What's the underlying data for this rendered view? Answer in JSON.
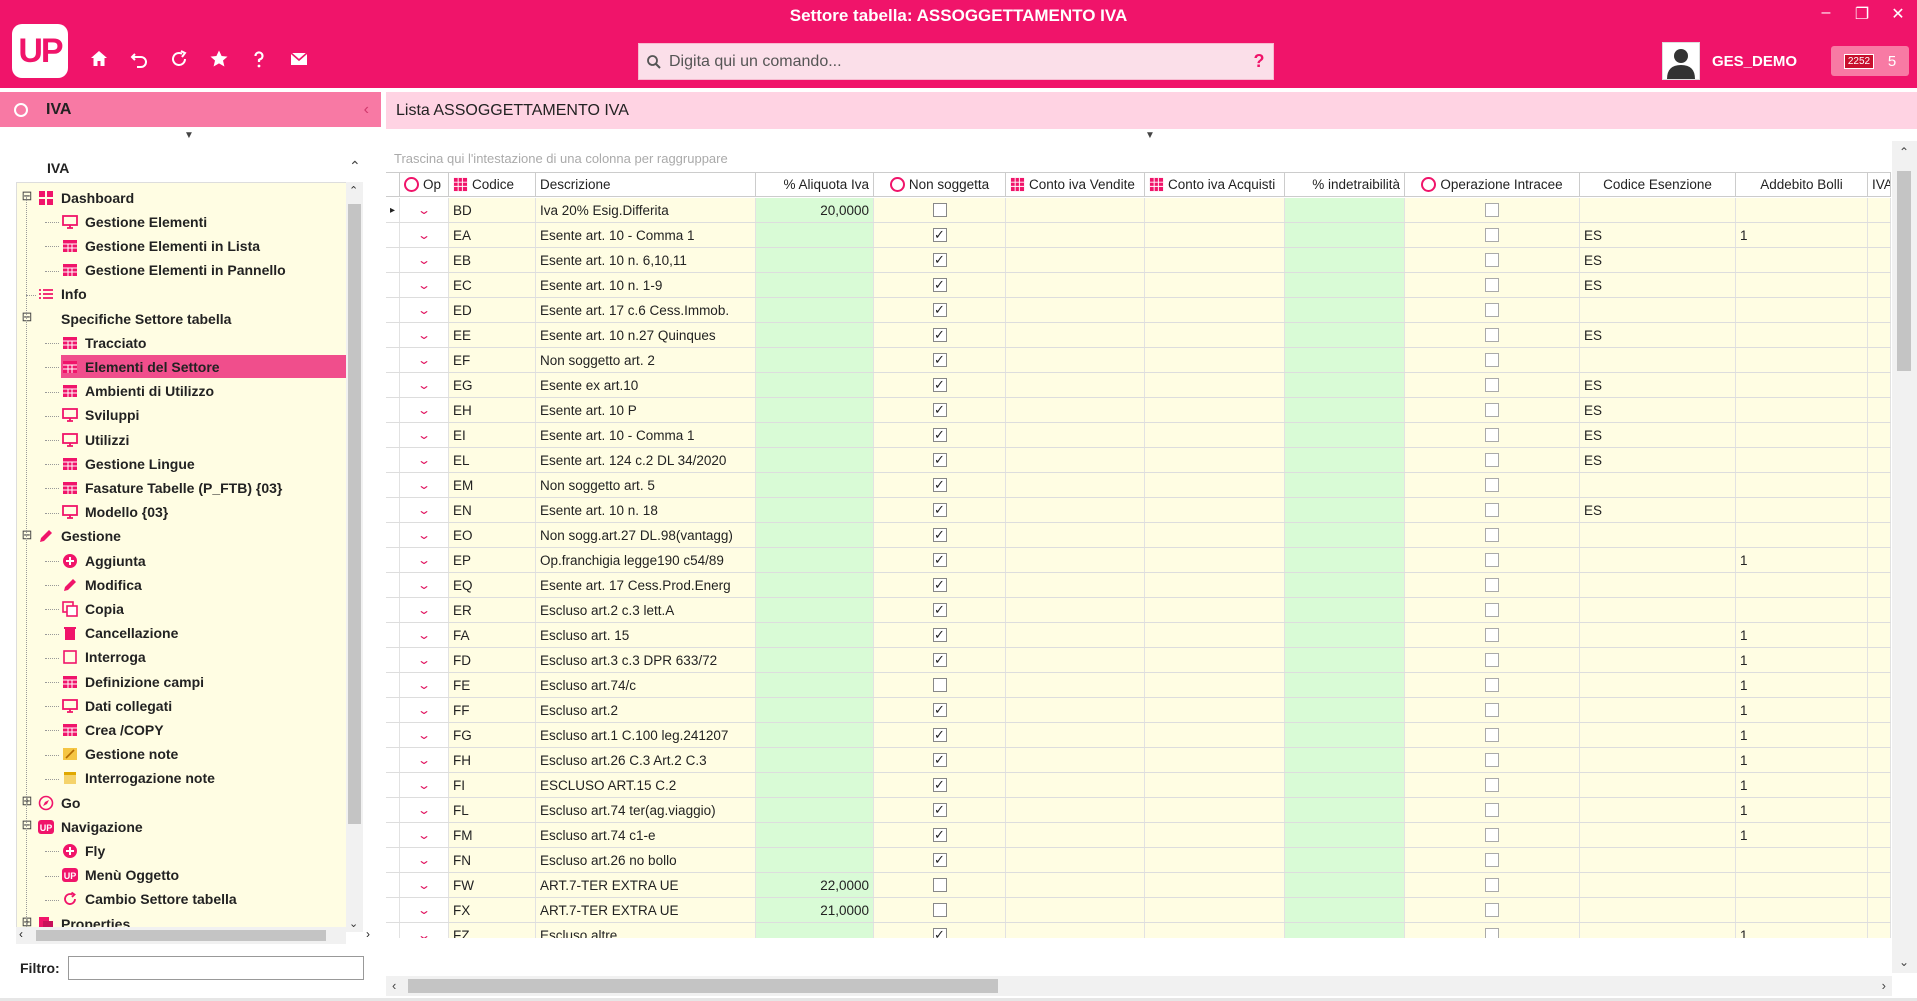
{
  "window": {
    "title": "Settore tabella: ASSOGGETTAMENTO IVA",
    "minimize": "–",
    "restore": "❐",
    "close": "✕"
  },
  "app": {
    "logo_text": "UP",
    "accent_color": "#f0146a",
    "panel_color": "#f879a4",
    "tree_bg": "#fffde3",
    "green_col": "#d9fbd6"
  },
  "toolbar": {
    "icons": [
      "home-icon",
      "undo-icon",
      "refresh-icon",
      "star-icon",
      "help-icon",
      "mail-icon"
    ]
  },
  "command": {
    "placeholder": "Digita qui un comando...",
    "help": "?"
  },
  "user": {
    "name": "GES_DEMO",
    "notif_badge": "2252",
    "notif_count": "5"
  },
  "left": {
    "title": "IVA",
    "collapse": "‹",
    "drop": "▼",
    "section": "IVA",
    "section_up": "⌃",
    "filter_label": "Filtro:",
    "filter_value": "",
    "scroll_left": "‹",
    "scroll_right": "›",
    "scroll_up": "⌃",
    "scroll_down": "⌄",
    "tree": [
      {
        "label": "Dashboard",
        "depth": 0,
        "icon": "dashboard-icon",
        "expander": "⊟"
      },
      {
        "label": "Gestione Elementi",
        "depth": 1,
        "icon": "monitor-icon"
      },
      {
        "label": "Gestione Elementi in Lista",
        "depth": 1,
        "icon": "grid-icon"
      },
      {
        "label": "Gestione Elementi in Pannello",
        "depth": 1,
        "icon": "grid-icon"
      },
      {
        "label": "Info",
        "depth": 0,
        "icon": "list-icon"
      },
      {
        "label": "Specifiche Settore tabella",
        "depth": 0,
        "icon": "",
        "expander": "⊟"
      },
      {
        "label": "Tracciato",
        "depth": 1,
        "icon": "grid-icon"
      },
      {
        "label": "Elementi del Settore",
        "depth": 1,
        "icon": "grid-icon",
        "selected": true
      },
      {
        "label": "Ambienti di Utilizzo",
        "depth": 1,
        "icon": "grid-icon"
      },
      {
        "label": "Sviluppi",
        "depth": 1,
        "icon": "monitor-icon"
      },
      {
        "label": "Utilizzi",
        "depth": 1,
        "icon": "monitor-icon"
      },
      {
        "label": "Gestione Lingue",
        "depth": 1,
        "icon": "grid-icon"
      },
      {
        "label": "Fasature Tabelle (P_FTB) {03}",
        "depth": 1,
        "icon": "grid-icon"
      },
      {
        "label": "Modello {03}",
        "depth": 1,
        "icon": "monitor-icon"
      },
      {
        "label": "Gestione",
        "depth": 0,
        "icon": "pencil-icon",
        "expander": "⊟"
      },
      {
        "label": "Aggiunta",
        "depth": 1,
        "icon": "add-circle-icon"
      },
      {
        "label": "Modifica",
        "depth": 1,
        "icon": "pencil-icon"
      },
      {
        "label": "Copia",
        "depth": 1,
        "icon": "copy-icon"
      },
      {
        "label": "Cancellazione",
        "depth": 1,
        "icon": "trash-icon"
      },
      {
        "label": "Interroga",
        "depth": 1,
        "icon": "square-icon"
      },
      {
        "label": "Definizione campi",
        "depth": 1,
        "icon": "grid-icon"
      },
      {
        "label": "Dati collegati",
        "depth": 1,
        "icon": "monitor-icon"
      },
      {
        "label": "Crea /COPY",
        "depth": 1,
        "icon": "grid-icon"
      },
      {
        "label": "Gestione note",
        "depth": 1,
        "icon": "note-edit-icon"
      },
      {
        "label": "Interrogazione note",
        "depth": 1,
        "icon": "note-icon"
      },
      {
        "label": "Go",
        "depth": 0,
        "icon": "compass-icon",
        "expander": "⊞"
      },
      {
        "label": "Navigazione",
        "depth": 0,
        "icon": "up-logo-icon",
        "expander": "⊟"
      },
      {
        "label": "Fly",
        "depth": 1,
        "icon": "add-circle-icon"
      },
      {
        "label": "Menù Oggetto",
        "depth": 1,
        "icon": "up-logo-icon"
      },
      {
        "label": "Cambio Settore tabella",
        "depth": 1,
        "icon": "refresh-icon"
      },
      {
        "label": "Properties",
        "depth": 0,
        "icon": "properties-icon",
        "expander": "⊞"
      }
    ]
  },
  "list": {
    "title": "Lista ASSOGGETTAMENTO IVA",
    "drop": "▼",
    "group_hint": "Trascina qui l'intestazione di una colonna per raggruppare",
    "scroll_up": "⌃",
    "scroll_down": "⌄",
    "scroll_left": "‹",
    "scroll_right": "›",
    "columns": [
      "Op",
      "Codice",
      "Descrizione",
      "% Aliquota Iva",
      "Non soggetta",
      "Conto iva Vendite",
      "Conto iva Acquisti",
      "% indetraibilità",
      "Operazione Intracee",
      "Codice Esenzione",
      "Addebito Bolli",
      "IVA"
    ],
    "row_pointer": "▸",
    "chevron": "⌄",
    "check_mark": "✓",
    "rows": [
      {
        "code": "BD",
        "desc": "Iva 20% Esig.Differita",
        "aliq": "20,0000",
        "non_sogg": false,
        "esenz": "",
        "bolli": "",
        "pointer": true
      },
      {
        "code": "EA",
        "desc": "Esente art. 10 - Comma 1",
        "aliq": "",
        "non_sogg": true,
        "esenz": "ES",
        "bolli": "1"
      },
      {
        "code": "EB",
        "desc": "Esente art. 10 n. 6,10,11",
        "aliq": "",
        "non_sogg": true,
        "esenz": "ES",
        "bolli": ""
      },
      {
        "code": "EC",
        "desc": "Esente art. 10 n. 1-9",
        "aliq": "",
        "non_sogg": true,
        "esenz": "ES",
        "bolli": ""
      },
      {
        "code": "ED",
        "desc": "Esente art. 17 c.6 Cess.Immob.",
        "aliq": "",
        "non_sogg": true,
        "esenz": "",
        "bolli": ""
      },
      {
        "code": "EE",
        "desc": "Esente art. 10 n.27 Quinques",
        "aliq": "",
        "non_sogg": true,
        "esenz": "ES",
        "bolli": ""
      },
      {
        "code": "EF",
        "desc": "Non soggetto art. 2",
        "aliq": "",
        "non_sogg": true,
        "esenz": "",
        "bolli": ""
      },
      {
        "code": "EG",
        "desc": "Esente ex art.10",
        "aliq": "",
        "non_sogg": true,
        "esenz": "ES",
        "bolli": ""
      },
      {
        "code": "EH",
        "desc": "Esente art.  10 P",
        "aliq": "",
        "non_sogg": true,
        "esenz": "ES",
        "bolli": ""
      },
      {
        "code": "EI",
        "desc": "Esente art. 10 - Comma 1",
        "aliq": "",
        "non_sogg": true,
        "esenz": "ES",
        "bolli": ""
      },
      {
        "code": "EL",
        "desc": "Esente art. 124 c.2 DL 34/2020",
        "aliq": "",
        "non_sogg": true,
        "esenz": "ES",
        "bolli": ""
      },
      {
        "code": "EM",
        "desc": "Non soggetto art. 5",
        "aliq": "",
        "non_sogg": true,
        "esenz": "",
        "bolli": ""
      },
      {
        "code": "EN",
        "desc": "Esente art. 10 n. 18",
        "aliq": "",
        "non_sogg": true,
        "esenz": "ES",
        "bolli": ""
      },
      {
        "code": "EO",
        "desc": "Non sogg.art.27 DL.98(vantagg)",
        "aliq": "",
        "non_sogg": true,
        "esenz": "",
        "bolli": ""
      },
      {
        "code": "EP",
        "desc": "Op.franchigia legge190 c54/89",
        "aliq": "",
        "non_sogg": true,
        "esenz": "",
        "bolli": "1"
      },
      {
        "code": "EQ",
        "desc": "Esente art. 17 Cess.Prod.Energ",
        "aliq": "",
        "non_sogg": true,
        "esenz": "",
        "bolli": ""
      },
      {
        "code": "ER",
        "desc": "Escluso art.2 c.3 lett.A",
        "aliq": "",
        "non_sogg": true,
        "esenz": "",
        "bolli": ""
      },
      {
        "code": "FA",
        "desc": "Escluso art. 15",
        "aliq": "",
        "non_sogg": true,
        "esenz": "",
        "bolli": "1"
      },
      {
        "code": "FD",
        "desc": "Escluso art.3 c.3 DPR 633/72",
        "aliq": "",
        "non_sogg": true,
        "esenz": "",
        "bolli": "1"
      },
      {
        "code": "FE",
        "desc": "Escluso art.74/c",
        "aliq": "",
        "non_sogg": false,
        "esenz": "",
        "bolli": "1"
      },
      {
        "code": "FF",
        "desc": "Escluso art.2",
        "aliq": "",
        "non_sogg": true,
        "esenz": "",
        "bolli": "1"
      },
      {
        "code": "FG",
        "desc": "Escluso art.1 C.100 leg.241207",
        "aliq": "",
        "non_sogg": true,
        "esenz": "",
        "bolli": "1"
      },
      {
        "code": "FH",
        "desc": "Escluso art.26 C.3 Art.2 C.3",
        "aliq": "",
        "non_sogg": true,
        "esenz": "",
        "bolli": "1"
      },
      {
        "code": "FI",
        "desc": "ESCLUSO ART.15 C.2",
        "aliq": "",
        "non_sogg": true,
        "esenz": "",
        "bolli": "1"
      },
      {
        "code": "FL",
        "desc": "Escluso art.74 ter(ag.viaggio)",
        "aliq": "",
        "non_sogg": true,
        "esenz": "",
        "bolli": "1"
      },
      {
        "code": "FM",
        "desc": "Escluso art.74 c1-e",
        "aliq": "",
        "non_sogg": true,
        "esenz": "",
        "bolli": "1"
      },
      {
        "code": "FN",
        "desc": "Escluso art.26 no bollo",
        "aliq": "",
        "non_sogg": true,
        "esenz": "",
        "bolli": ""
      },
      {
        "code": "FW",
        "desc": "ART.7-TER EXTRA UE",
        "aliq": "22,0000",
        "non_sogg": false,
        "esenz": "",
        "bolli": ""
      },
      {
        "code": "FX",
        "desc": "ART.7-TER EXTRA UE",
        "aliq": "21,0000",
        "non_sogg": false,
        "esenz": "",
        "bolli": ""
      },
      {
        "code": "FZ",
        "desc": "Escluso altre",
        "aliq": "",
        "non_sogg": true,
        "esenz": "",
        "bolli": "1"
      }
    ]
  }
}
